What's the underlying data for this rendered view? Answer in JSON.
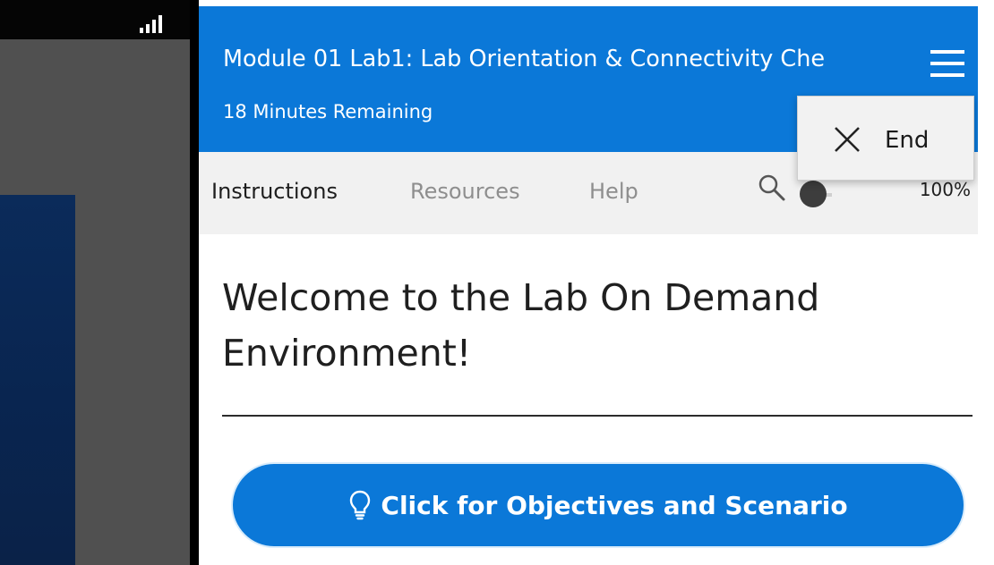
{
  "header": {
    "title": "Module 01 Lab1: Lab Orientation & Connectivity Che",
    "timer": "18 Minutes Remaining",
    "menu_icon": "hamburger-menu-icon"
  },
  "end_menu": {
    "label": "End",
    "icon": "close-icon"
  },
  "tabs": [
    {
      "label": "Instructions",
      "active": true
    },
    {
      "label": "Resources",
      "active": false
    },
    {
      "label": "Help",
      "active": false
    }
  ],
  "zoom": {
    "icon": "search-icon",
    "value_text": "100%",
    "level": 0.0
  },
  "content": {
    "heading": "Welcome to the Lab On Demand Environment!",
    "objectives_button": "Click for Objectives and Scenario",
    "objectives_icon": "lightbulb-icon"
  },
  "vm": {
    "signal_icon": "signal-strength-icon"
  },
  "colors": {
    "accent": "#0b78d8",
    "tab_bar": "#f1f1f1",
    "vm_panel": "#505050",
    "vm_desktop": "#0b2b5a"
  }
}
